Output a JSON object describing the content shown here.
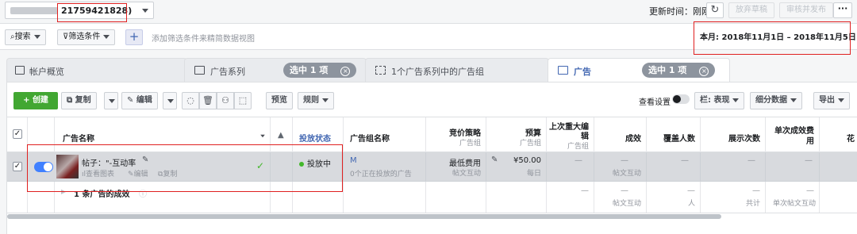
{
  "topbar": {
    "account_id": "21759421828)",
    "updated_label": "更新时间：刚刚",
    "discard_label": "放弃草稿",
    "review_label": "审核并发布",
    "more_label": "···"
  },
  "filterbar": {
    "search_label": "搜索",
    "filter_label": "筛选条件",
    "plus_label": "+",
    "hint": "添加筛选条件来精简数据视图",
    "date_range": "本月: 2018年11月1日 – 2018年11月5日"
  },
  "tabs": {
    "overview": "帐户概览",
    "campaigns": "广告系列",
    "campaigns_pill": "选中 1 项",
    "adsets": "1个广告系列中的广告组",
    "ads": "广告",
    "ads_pill": "选中 1 项",
    "pill_close": "×"
  },
  "toolbar": {
    "create": "创建",
    "create_plus": "+",
    "copy": "复制",
    "edit": "编辑",
    "preview": "预览",
    "rules": "规则",
    "view_settings": "查看设置",
    "columns": "栏: 表现",
    "breakdown": "细分数据",
    "export": "导出"
  },
  "table": {
    "headers": {
      "ad_name": "广告名称",
      "warning": "▲",
      "status": "投放状态",
      "adset_name": "广告组名称",
      "bid_strategy": "竞价策略",
      "bid_sub": "广告组",
      "budget": "预算",
      "budget_sub": "广告组",
      "last_edit_1": "上次重大编",
      "last_edit_2": "辑",
      "last_edit_sub": "广告组",
      "results": "成效",
      "reach": "覆盖人数",
      "impressions": "展示次数",
      "cost_per_1": "单次成效费",
      "cost_per_2": "用",
      "spend": "花"
    },
    "row": {
      "ad_name": "帖子：\"-互动率",
      "view_chart": "查看图表",
      "edit": "编辑",
      "duplicate": "复制",
      "status": "投放中",
      "adset_name": "M",
      "adset_sub": "0个正在投放的广告",
      "bid": "最低费用",
      "bid_sub": "帖文互动",
      "budget": "¥50.00",
      "budget_sub": "每日",
      "last_edit": "—",
      "results": "—",
      "results_sub": "帖文互动",
      "reach": "—",
      "impressions": "—",
      "cost_per": "—"
    },
    "summary": {
      "label": "1 条广告的成效",
      "last_edit": "—",
      "results": "—",
      "results_sub": "帖文互动",
      "reach": "—",
      "reach_sub": "人",
      "impressions": "—",
      "impressions_sub": "共计",
      "cost_per": "—",
      "cost_per_sub": "单次帖文互动"
    }
  },
  "colors": {
    "create_green": "#42a732",
    "accent_blue": "#4267b2",
    "toggle_blue": "#4080ff",
    "annotation_red": "#e02020"
  }
}
